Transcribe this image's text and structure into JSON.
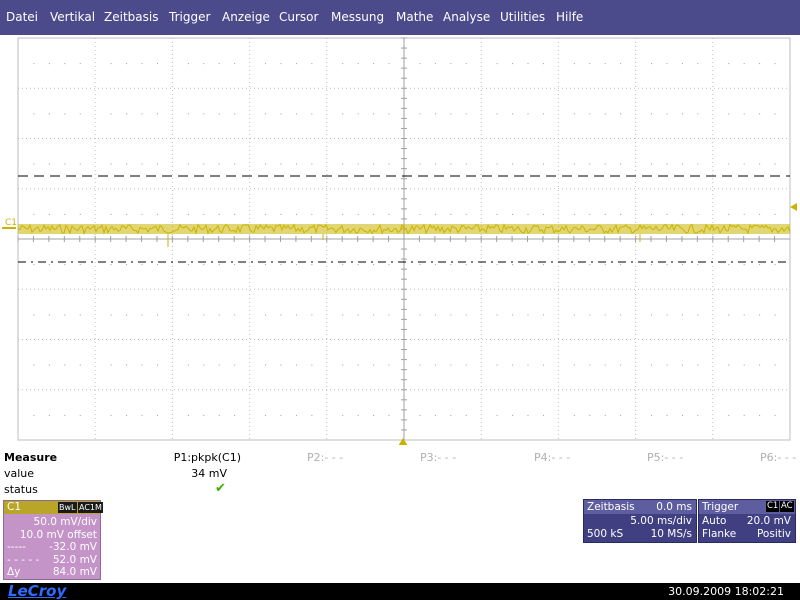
{
  "menu": [
    "Datei",
    "Vertikal",
    "Zeitbasis",
    "Trigger",
    "Anzeige",
    "Cursor",
    "Messung",
    "Mathe",
    "Analyse",
    "Utilities",
    "Hilfe"
  ],
  "scope": {
    "channel_marker": "C1",
    "colors": {
      "grid": "#bdbdbd",
      "trace": "#c8b400",
      "cursor": "#000000",
      "trigger": "#c8b400"
    }
  },
  "measure": {
    "title": "Measure",
    "row_value": "value",
    "row_status": "status",
    "params": [
      {
        "name": "P1:pkpk(C1)",
        "value": "34 mV",
        "status": "ok"
      },
      {
        "name": "P2:- - -"
      },
      {
        "name": "P3:- - -"
      },
      {
        "name": "P4:- - -"
      },
      {
        "name": "P5:- - -"
      },
      {
        "name": "P6:- - -"
      }
    ]
  },
  "channel": {
    "name": "C1",
    "badge_bwl": "BwL",
    "badge_coupling": "AC1M",
    "vdiv": "50.0 mV/div",
    "offset": "10.0 mV offset",
    "cursor1_label": "-----",
    "cursor1_value": "-32.0 mV",
    "cursor2_label": "- - - - -",
    "cursor2_value": "52.0 mV",
    "delta_label": "Δy",
    "delta_value": "84.0 mV",
    "color": "#c494c8"
  },
  "timebase": {
    "title": "Zeitbasis",
    "delay": "0.0 ms",
    "tdiv": "5.00 ms/div",
    "samples": "500 kS",
    "rate": "10 MS/s"
  },
  "trigger": {
    "title": "Trigger",
    "badge_source": "C1",
    "badge_coupling": "AC",
    "mode": "Auto",
    "level": "20.0 mV",
    "type": "Flanke",
    "slope": "Positiv"
  },
  "footer": {
    "logo": "LeCroy",
    "datetime": "30.09.2009 18:02:21"
  }
}
